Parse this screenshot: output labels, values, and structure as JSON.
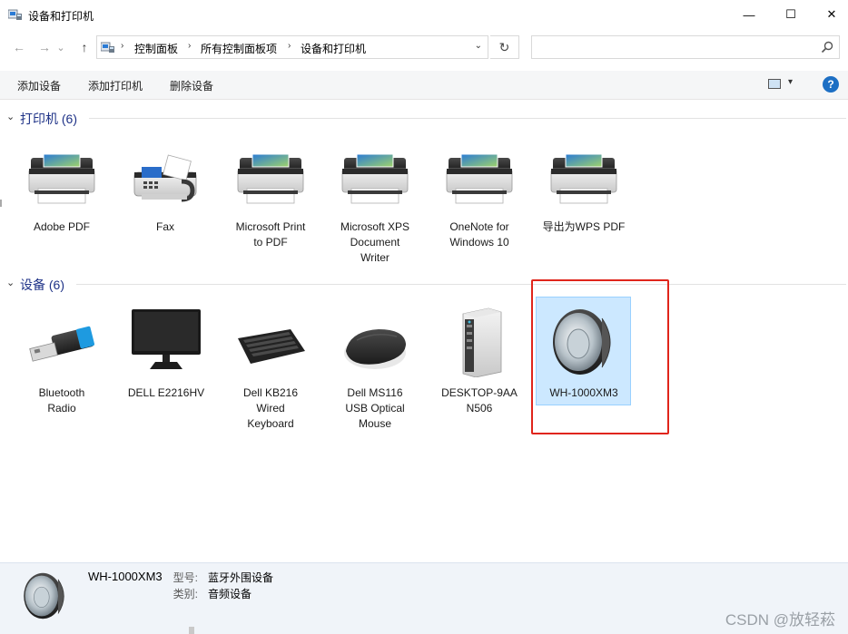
{
  "window": {
    "title": "设备和打印机",
    "controls": {
      "minimize": "—",
      "maximize": "☐",
      "close": "✕"
    }
  },
  "navigation": {
    "back_icon": "←",
    "forward_icon": "→",
    "recent_icon": "⌄",
    "up_icon": "↑",
    "breadcrumb": [
      "控制面板",
      "所有控制面板项",
      "设备和打印机"
    ],
    "separator": "›",
    "dropdown_icon": "⌄",
    "refresh_icon": "↻",
    "search_placeholder": ""
  },
  "command_bar": {
    "add_device": "添加设备",
    "add_printer": "添加打印机",
    "remove_device": "删除设备",
    "view_dropdown_icon": "▾",
    "help_label": "?"
  },
  "groups": {
    "printers": {
      "chevron": "⌄",
      "title": "打印机 (6)",
      "items": [
        {
          "label_lines": [
            "Adobe PDF"
          ],
          "icon": "printer-icon"
        },
        {
          "label_lines": [
            "Fax"
          ],
          "icon": "fax-icon"
        },
        {
          "label_lines": [
            "Microsoft Print",
            "to PDF"
          ],
          "icon": "printer-icon"
        },
        {
          "label_lines": [
            "Microsoft XPS",
            "Document",
            "Writer"
          ],
          "icon": "printer-icon"
        },
        {
          "label_lines": [
            "OneNote for",
            "Windows 10"
          ],
          "icon": "printer-icon"
        },
        {
          "label_lines": [
            "导出为WPS PDF"
          ],
          "icon": "printer-icon"
        }
      ]
    },
    "devices": {
      "chevron": "⌄",
      "title": "设备 (6)",
      "items": [
        {
          "label_lines": [
            "Bluetooth",
            "Radio"
          ],
          "icon": "usb-bluetooth-dongle-icon"
        },
        {
          "label_lines": [
            "DELL E2216HV"
          ],
          "icon": "monitor-icon"
        },
        {
          "label_lines": [
            "Dell KB216",
            "Wired",
            "Keyboard"
          ],
          "icon": "keyboard-icon"
        },
        {
          "label_lines": [
            "Dell MS116",
            "USB Optical",
            "Mouse"
          ],
          "icon": "mouse-icon"
        },
        {
          "label_lines": [
            "DESKTOP-9AA",
            "N506"
          ],
          "icon": "computer-tower-icon"
        },
        {
          "label_lines": [
            "WH-1000XM3"
          ],
          "icon": "speaker-icon",
          "selected": true
        }
      ]
    }
  },
  "details": {
    "name": "WH-1000XM3",
    "model_key": "型号:",
    "model_value": "蓝牙外围设备",
    "category_key": "类别:",
    "category_value": "音频设备",
    "icon": "speaker-icon"
  },
  "watermark": "CSDN @放轻菘",
  "colors": {
    "group_title": "#1e3287",
    "selection_fill": "#cce8ff",
    "selection_border": "#99d1ff",
    "highlight_frame": "#e0251b",
    "details_bg": "#f0f4f9",
    "help": "#1d6fc4"
  }
}
